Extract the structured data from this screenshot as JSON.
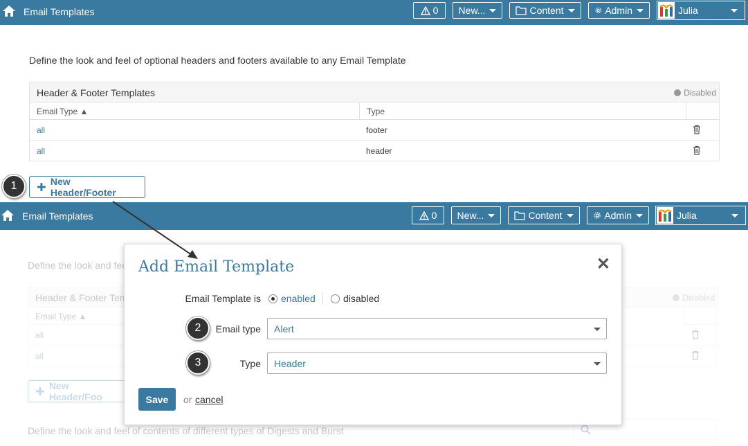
{
  "app_title": "Email Templates",
  "nav": {
    "alerts_count": "0",
    "new_label": "New...",
    "content_label": "Content",
    "admin_label": "Admin",
    "user_name": "Julia"
  },
  "intro_text": "Define the look and feel of optional headers and footers available to any Email Template",
  "panel": {
    "title": "Header & Footer Templates",
    "status": "Disabled",
    "columns": [
      "Email Type ▲",
      "Type"
    ],
    "rows": [
      {
        "email_type": "all",
        "type": "footer"
      },
      {
        "email_type": "all",
        "type": "header"
      }
    ]
  },
  "new_button_label": "New Header/Footer",
  "new_button_label_bottom": "New Header/Foo",
  "intro_text_bottom_visible": "Define the look and fee",
  "panel_title_bottom_visible": "Header & Footer Tem",
  "digests_text": "Define the look and feel of contents of different types of Digests and Burst",
  "steps": [
    "1",
    "2",
    "3"
  ],
  "modal": {
    "title": "Add Email Template",
    "status_label": "Email Template is",
    "status_options": [
      "enabled",
      "disabled"
    ],
    "status_selected": "enabled",
    "email_type_label": "Email type",
    "email_type_value": "Alert",
    "type_label": "Type",
    "type_value": "Header",
    "save_label": "Save",
    "or_text": "or",
    "cancel_label": "cancel",
    "close_symbol": "✕"
  },
  "colors": {
    "brand": "#3b7aa0",
    "step_badge": "#333333"
  }
}
